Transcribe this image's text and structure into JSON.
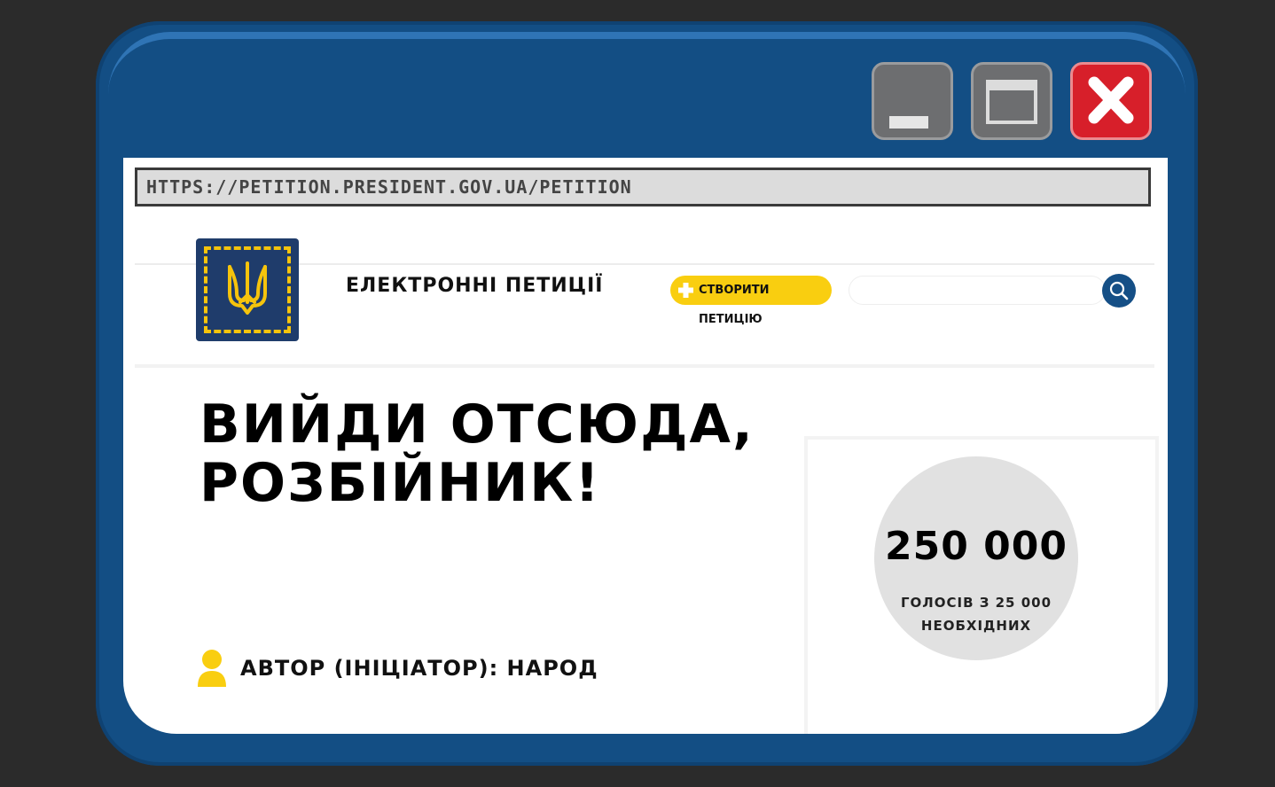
{
  "browser": {
    "url": "HTTPS://PETITION.PRESIDENT.GOV.UA/PETITION"
  },
  "header": {
    "site_title": "ЕЛЕКТРОННІ ПЕТИЦІЇ",
    "create_label": "СТВОРИТИ ПЕТИЦІЮ",
    "search_placeholder": "",
    "icons": [
      "trident-emblem-icon",
      "plus-icon",
      "search-icon"
    ]
  },
  "petition": {
    "title": "ВИЙДИ ОТСЮДА, РОЗБІЙНИК!",
    "author_label": "АВТОР (ІНІЦІАТОР): НАРОД",
    "vote_count": "250 000",
    "vote_caption": "ГОЛОСІВ З 25 000 НЕОБХІДНИХ"
  },
  "colors": {
    "window_frame": "#134e84",
    "close_button": "#d71f2a",
    "accent_yellow": "#f9ce10",
    "emblem_bg": "#1f3c6b"
  }
}
